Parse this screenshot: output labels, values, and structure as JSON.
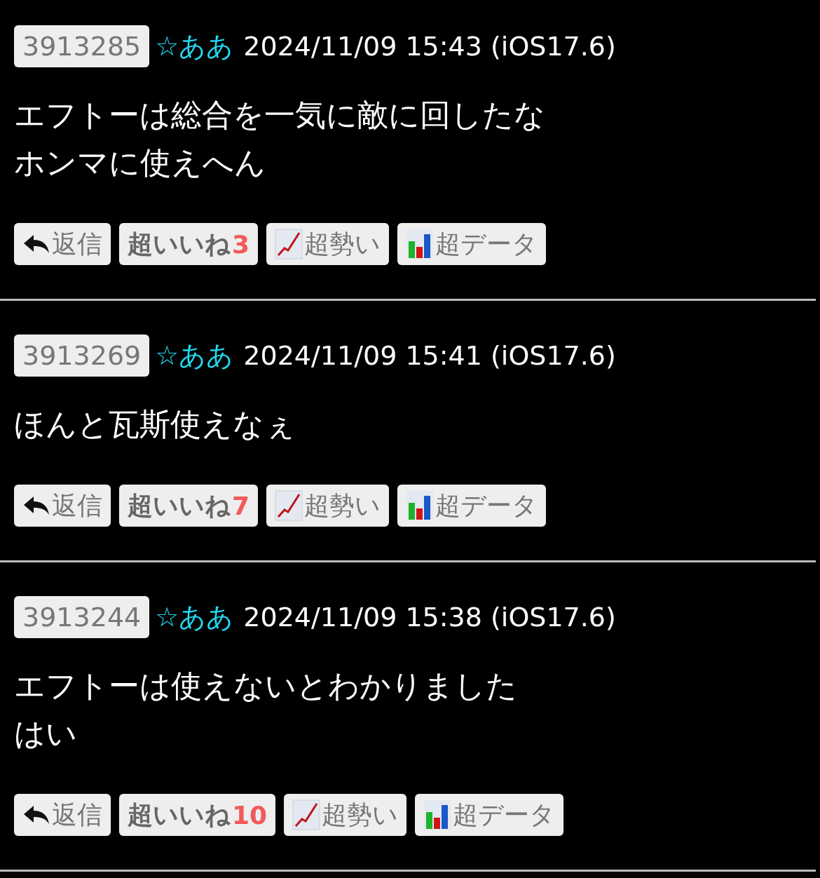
{
  "posts": [
    {
      "number": "3913285",
      "name": "☆ああ",
      "date": "2024/11/09 15:43 (iOS17.6)",
      "body": [
        "エフトーは総合を一気に敵に回したな",
        "ホンマに使えへん"
      ],
      "actions": {
        "reply": "返信",
        "like": "超いいね",
        "like_count": "3",
        "trend": "超勢い",
        "data": "超データ"
      }
    },
    {
      "number": "3913269",
      "name": "☆ああ",
      "date": "2024/11/09 15:41 (iOS17.6)",
      "body": [
        "ほんと瓦斯使えなぇ"
      ],
      "actions": {
        "reply": "返信",
        "like": "超いいね",
        "like_count": "7",
        "trend": "超勢い",
        "data": "超データ"
      }
    },
    {
      "number": "3913244",
      "name": "☆ああ",
      "date": "2024/11/09 15:38 (iOS17.6)",
      "body": [
        "エフトーは使えないとわかりました",
        "はい"
      ],
      "actions": {
        "reply": "返信",
        "like": "超いいね",
        "like_count": "10",
        "trend": "超勢い",
        "data": "超データ"
      }
    }
  ]
}
